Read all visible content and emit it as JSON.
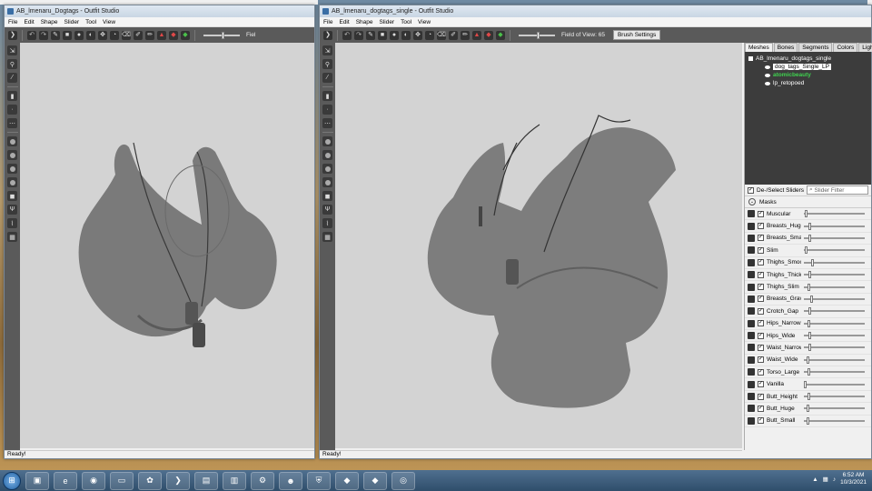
{
  "windows": [
    {
      "title": "AB_lmenaru_Dogtags - Outfit Studio",
      "menu": [
        "File",
        "Edit",
        "Shape",
        "Slider",
        "Tool",
        "View"
      ],
      "toolbar_trunc_label": "Fiel",
      "status": "Ready!"
    },
    {
      "title": "AB_lmenaru_dogtags_single - Outfit Studio",
      "menu": [
        "File",
        "Edit",
        "Shape",
        "Slider",
        "Tool",
        "View"
      ],
      "fov_label": "Field of View: 65",
      "brush_settings_label": "Brush Settings",
      "status": "Ready!"
    }
  ],
  "panel": {
    "tabs": [
      "Meshes",
      "Bones",
      "Segments",
      "Colors",
      "Lights"
    ],
    "active_tab": "Meshes",
    "project": "AB_lmenaru_dogtags_single",
    "meshes": [
      {
        "label": "dog_tags_Single_LP",
        "state": "selected"
      },
      {
        "label": "atomicbeauty",
        "state": "green"
      },
      {
        "label": "lp_retopoed",
        "state": "normal"
      }
    ],
    "deselect_label": "De-/Select Sliders",
    "filter_placeholder": "Slider Filter",
    "masks_label": "Masks",
    "sliders": [
      {
        "name": "Muscular",
        "value": 0.02
      },
      {
        "name": "Breasts_Huge",
        "value": 0.08
      },
      {
        "name": "Breasts_Small",
        "value": 0.08
      },
      {
        "name": "Slim",
        "value": 0.02
      },
      {
        "name": "Thighs_Smooth",
        "value": 0.12
      },
      {
        "name": "Thighs_Thick",
        "value": 0.08
      },
      {
        "name": "Thighs_Slim",
        "value": 0.06
      },
      {
        "name": "Breasts_Gravity",
        "value": 0.1
      },
      {
        "name": "Crotch_Gap",
        "value": 0.08
      },
      {
        "name": "Hips_Narrow",
        "value": 0.06
      },
      {
        "name": "Hips_Wide",
        "value": 0.08
      },
      {
        "name": "Waist_Narrow",
        "value": 0.08
      },
      {
        "name": "Waist_Wide",
        "value": 0.04
      },
      {
        "name": "Torso_Large",
        "value": 0.06
      },
      {
        "name": "Vanilla",
        "value": 0.0
      },
      {
        "name": "Butt_Height",
        "value": 0.06
      },
      {
        "name": "Butt_Huge",
        "value": 0.05
      },
      {
        "name": "Butt_Small",
        "value": 0.04
      }
    ]
  },
  "taskbar": {
    "apps": [
      "explorer-icon",
      "ie-icon",
      "chrome-icon",
      "app-icon",
      "paint-icon",
      "winamp-icon",
      "terminal-icon",
      "files-icon",
      "steam-icon",
      "discord-icon",
      "shield-icon",
      "outfit-icon",
      "outfit2-icon",
      "media-icon"
    ],
    "time": "6:52 AM",
    "date": "10/3/2021"
  }
}
